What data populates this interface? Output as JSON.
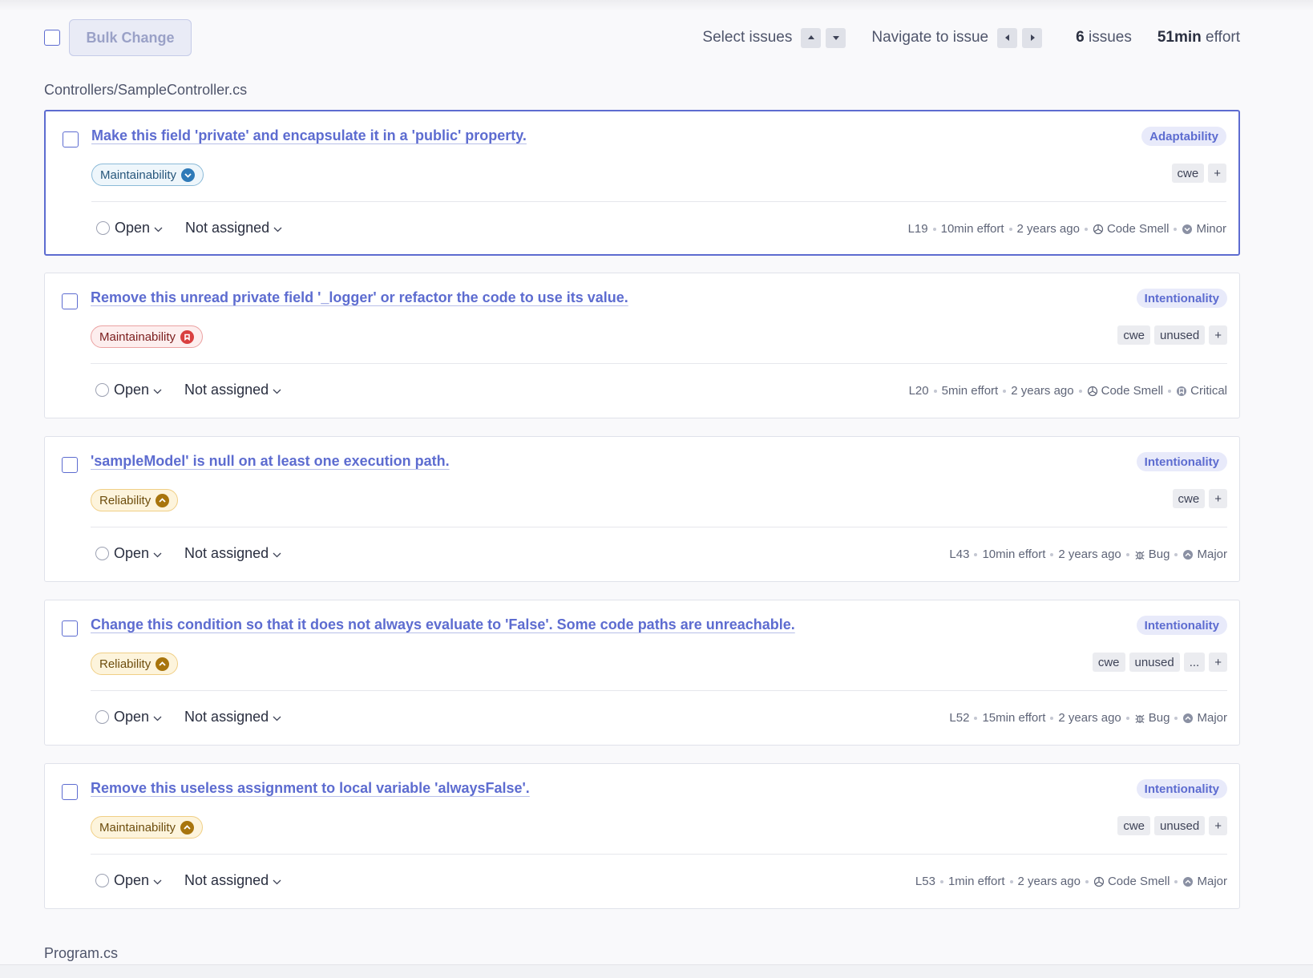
{
  "toolbar": {
    "bulk_change_label": "Bulk Change",
    "select_issues_label": "Select issues",
    "navigate_label": "Navigate to issue",
    "issues_count": "6",
    "issues_suffix": " issues",
    "effort_value": "51min",
    "effort_suffix": " effort"
  },
  "files": [
    {
      "name": "Controllers/SampleController.cs"
    },
    {
      "name": "Program.cs"
    }
  ],
  "issues": [
    {
      "title": "Make this field 'private' and encapsulate it in a 'public' property.",
      "attribute": "Adaptability",
      "quality": "Maintainability",
      "quality_severity_icon": "low-severity-icon",
      "tags": [
        "cwe",
        "+"
      ],
      "status": "Open",
      "assignee": "Not assigned",
      "line": "L19",
      "effort": "10min effort",
      "age": "2 years ago",
      "type": "Code Smell",
      "severity": "Minor",
      "selected": true
    },
    {
      "title": "Remove this unread private field '_logger' or refactor the code to use its value.",
      "attribute": "Intentionality",
      "quality": "Maintainability",
      "quality_severity_icon": "high-severity-icon",
      "tags": [
        "cwe",
        "unused",
        "+"
      ],
      "status": "Open",
      "assignee": "Not assigned",
      "line": "L20",
      "effort": "5min effort",
      "age": "2 years ago",
      "type": "Code Smell",
      "severity": "Critical",
      "selected": false
    },
    {
      "title": "'sampleModel' is null on at least one execution path.",
      "attribute": "Intentionality",
      "quality": "Reliability",
      "quality_severity_icon": "medium-severity-icon",
      "tags": [
        "cwe",
        "+"
      ],
      "status": "Open",
      "assignee": "Not assigned",
      "line": "L43",
      "effort": "10min effort",
      "age": "2 years ago",
      "type": "Bug",
      "severity": "Major",
      "selected": false
    },
    {
      "title": "Change this condition so that it does not always evaluate to 'False'. Some code paths are unreachable.",
      "attribute": "Intentionality",
      "quality": "Reliability",
      "quality_severity_icon": "medium-severity-icon",
      "tags": [
        "cwe",
        "unused",
        "...",
        "+"
      ],
      "status": "Open",
      "assignee": "Not assigned",
      "line": "L52",
      "effort": "15min effort",
      "age": "2 years ago",
      "type": "Bug",
      "severity": "Major",
      "selected": false
    },
    {
      "title": "Remove this useless assignment to local variable 'alwaysFalse'.",
      "attribute": "Intentionality",
      "quality": "Maintainability",
      "quality_severity_icon": "medium-severity-icon",
      "tags": [
        "cwe",
        "unused",
        "+"
      ],
      "status": "Open",
      "assignee": "Not assigned",
      "line": "L53",
      "effort": "1min effort",
      "age": "2 years ago",
      "type": "Code Smell",
      "severity": "Major",
      "selected": false
    }
  ],
  "colors": {
    "accent": "#5d6cd0",
    "low_blue": "#2f7ab8",
    "high_red": "#d93f3f",
    "medium_yellow": "#a8750d"
  }
}
